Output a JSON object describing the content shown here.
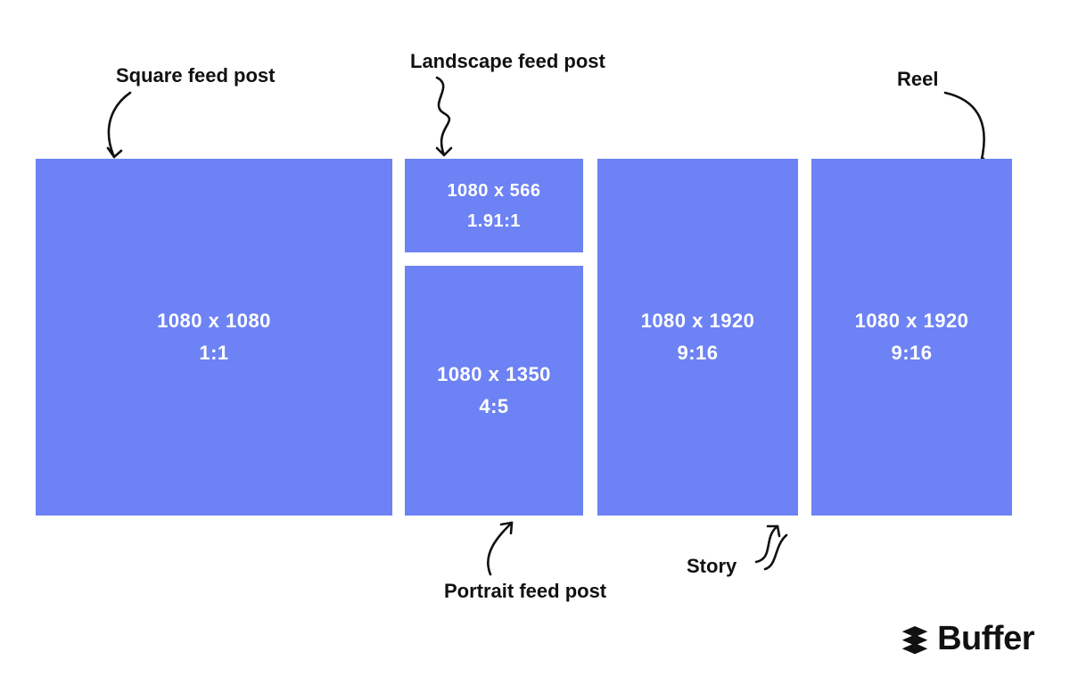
{
  "labels": {
    "square": "Square feed post",
    "landscape": "Landscape feed post",
    "portrait": "Portrait feed post",
    "story": "Story",
    "reel": "Reel"
  },
  "boxes": {
    "square": {
      "dims": "1080 x 1080",
      "ratio": "1:1"
    },
    "landscape": {
      "dims": "1080 x 566",
      "ratio": "1.91:1"
    },
    "portrait": {
      "dims": "1080 x 1350",
      "ratio": "4:5"
    },
    "story": {
      "dims": "1080 x 1920",
      "ratio": "9:16"
    },
    "reel": {
      "dims": "1080 x 1920",
      "ratio": "9:16"
    }
  },
  "brand": "Buffer",
  "colors": {
    "box_bg": "#6d82f4",
    "text": "#111111",
    "white": "#ffffff"
  }
}
